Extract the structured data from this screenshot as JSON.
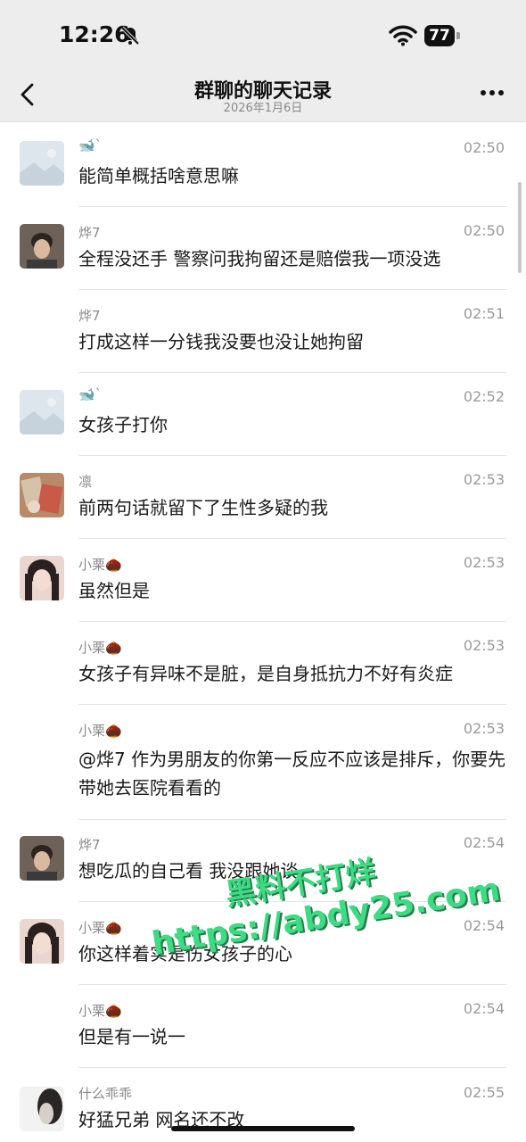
{
  "status": {
    "time": "12:26",
    "battery": "77",
    "icons": [
      "bell-muted-icon",
      "wifi-icon",
      "battery-icon"
    ]
  },
  "nav": {
    "title": "群聊的聊天记录",
    "date": "2026年1月6日",
    "back_icon": "chevron-left-icon",
    "more_icon": "more-dots-icon"
  },
  "messages": [
    {
      "name": "🐋`",
      "time": "02:50",
      "text": "能简单概括啥意思嘛"
    },
    {
      "name": "烨7",
      "time": "02:50",
      "text": "全程没还手 警察问我拘留还是赔偿我一项没选"
    },
    {
      "name": "烨7",
      "time": "02:51",
      "text": "打成这样一分钱我没要也没让她拘留"
    },
    {
      "name": "🐋`",
      "time": "02:52",
      "text": "女孩子打你"
    },
    {
      "name": "凛",
      "time": "02:53",
      "text": "前两句话就留下了生性多疑的我"
    },
    {
      "name": "小栗🌰",
      "time": "02:53",
      "text": "虽然但是"
    },
    {
      "name": "小栗🌰",
      "time": "02:53",
      "text": "女孩子有异味不是脏，是自身抵抗力不好有炎症"
    },
    {
      "name": "小栗🌰",
      "time": "02:53",
      "text": "@烨7 作为男朋友的你第一反应不应该是排斥，你要先带她去医院看看的"
    },
    {
      "name": "烨7",
      "time": "02:54",
      "text": "想吃瓜的自己看 我没跟她谈"
    },
    {
      "name": "小栗🌰",
      "time": "02:54",
      "text": "你这样着实是伤女孩子的心"
    },
    {
      "name": "小栗🌰",
      "time": "02:54",
      "text": "但是有一说一"
    },
    {
      "name": "什么乖乖",
      "time": "02:55",
      "text": "好猛兄弟 网名还不改"
    }
  ],
  "watermark": {
    "line1": "黑料不打烊",
    "line2": "https://abdy25.com"
  }
}
